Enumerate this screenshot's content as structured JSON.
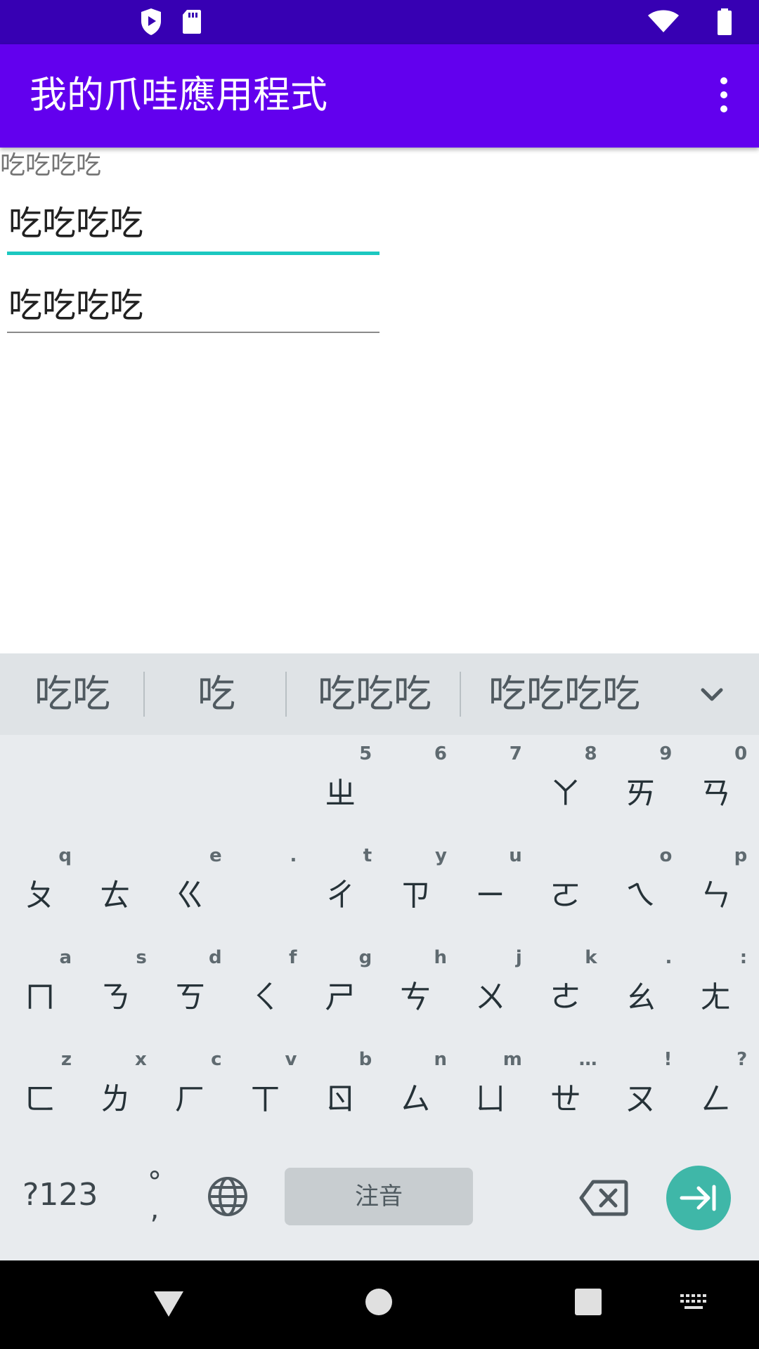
{
  "status_bar": {
    "left_icons": [
      "shield-play-icon",
      "sd-card-icon"
    ],
    "right_icons": [
      "wifi-icon",
      "battery-icon"
    ]
  },
  "app_bar": {
    "title": "我的爪哇應用程式",
    "menu_icon": "more-vert-icon"
  },
  "content": {
    "label": "吃吃吃吃",
    "field1_value": "吃吃吃吃",
    "field2_value": "吃吃吃吃"
  },
  "keyboard": {
    "suggestions": [
      "吃吃",
      "吃",
      "吃吃吃",
      "吃吃吃吃"
    ],
    "row1": [
      {
        "main": "",
        "hint": ""
      },
      {
        "main": "",
        "hint": ""
      },
      {
        "main": "",
        "hint": ""
      },
      {
        "main": "",
        "hint": ""
      },
      {
        "main": "ㄓ",
        "hint": "5"
      },
      {
        "main": "",
        "hint": "6"
      },
      {
        "main": "",
        "hint": "7"
      },
      {
        "main": "ㄚ",
        "hint": "8"
      },
      {
        "main": "ㄞ",
        "hint": "9"
      },
      {
        "main": "ㄢ",
        "hint": "0"
      }
    ],
    "row2": [
      {
        "main": "ㄆ",
        "hint": "q"
      },
      {
        "main": "ㄊ",
        "hint": ""
      },
      {
        "main": "ㄍ",
        "hint": "e"
      },
      {
        "main": "",
        "hint": "."
      },
      {
        "main": "ㄔ",
        "hint": "t"
      },
      {
        "main": "ㄗ",
        "hint": "y"
      },
      {
        "main": "ㄧ",
        "hint": "u"
      },
      {
        "main": "ㄛ",
        "hint": ""
      },
      {
        "main": "ㄟ",
        "hint": "o"
      },
      {
        "main": "ㄣ",
        "hint": "p"
      }
    ],
    "row3": [
      {
        "main": "ㄇ",
        "hint": "a"
      },
      {
        "main": "ㄋ",
        "hint": "s"
      },
      {
        "main": "ㄎ",
        "hint": "d"
      },
      {
        "main": "ㄑ",
        "hint": "f"
      },
      {
        "main": "ㄕ",
        "hint": "g"
      },
      {
        "main": "ㄘ",
        "hint": "h"
      },
      {
        "main": "ㄨ",
        "hint": "j"
      },
      {
        "main": "ㄜ",
        "hint": "k"
      },
      {
        "main": "ㄠ",
        "hint": "."
      },
      {
        "main": "ㄤ",
        "hint": ":"
      }
    ],
    "row4": [
      {
        "main": "ㄈ",
        "hint": "z"
      },
      {
        "main": "ㄌ",
        "hint": "x"
      },
      {
        "main": "ㄏ",
        "hint": "c"
      },
      {
        "main": "ㄒ",
        "hint": "v"
      },
      {
        "main": "ㄖ",
        "hint": "b"
      },
      {
        "main": "ㄙ",
        "hint": "n"
      },
      {
        "main": "ㄩ",
        "hint": "m"
      },
      {
        "main": "ㄝ",
        "hint": "…"
      },
      {
        "main": "ㄡ",
        "hint": "!"
      },
      {
        "main": "ㄥ",
        "hint": "?"
      }
    ],
    "symbols_label": "?123",
    "punct_label": "°\n,",
    "space_label": "注音",
    "accent_color": "#3fb7a8"
  },
  "nav_bar": {
    "icons": [
      "back-icon",
      "home-icon",
      "recents-icon",
      "keyboard-switch-icon"
    ]
  },
  "colors": {
    "status_bar": "#3700b3",
    "app_bar": "#6200ee",
    "field_focus": "#1cc8c0"
  }
}
